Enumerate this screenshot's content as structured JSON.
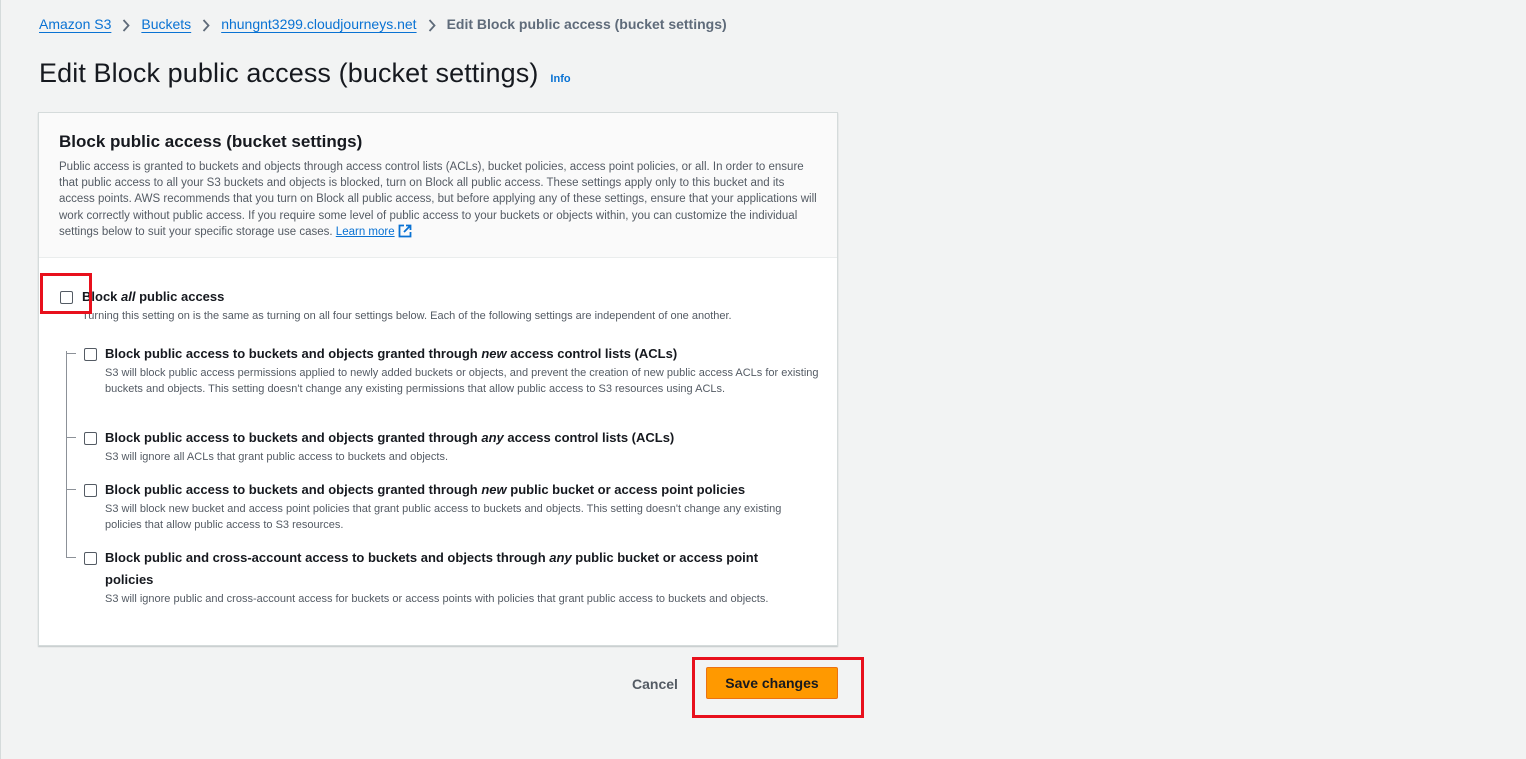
{
  "breadcrumb": {
    "items": [
      "Amazon S3",
      "Buckets",
      "nhungnt3299.cloudjourneys.net"
    ],
    "current": "Edit Block public access (bucket settings)"
  },
  "page": {
    "title": "Edit Block public access (bucket settings)",
    "info_label": "Info"
  },
  "panel": {
    "title": "Block public access (bucket settings)",
    "description": "Public access is granted to buckets and objects through access control lists (ACLs), bucket policies, access point policies, or all. In order to ensure that public access to all your S3 buckets and objects is blocked, turn on Block all public access. These settings apply only to this bucket and its access points. AWS recommends that you turn on Block all public access, but before applying any of these settings, ensure that your applications will work correctly without public access. If you require some level of public access to your buckets or objects within, you can customize the individual settings below to suit your specific storage use cases.",
    "learn_more": "Learn more"
  },
  "block_all": {
    "label_pre": "Block ",
    "label_em": "all",
    "label_post": " public access",
    "description": "Turning this setting on is the same as turning on all four settings below. Each of the following settings are independent of one another.",
    "checked": false
  },
  "settings": [
    {
      "label_pre": "Block public access to buckets and objects granted through ",
      "label_em": "new",
      "label_post": " access control lists (ACLs)",
      "description": "S3 will block public access permissions applied to newly added buckets or objects, and prevent the creation of new public access ACLs for existing buckets and objects. This setting doesn't change any existing permissions that allow public access to S3 resources using ACLs.",
      "checked": false
    },
    {
      "label_pre": "Block public access to buckets and objects granted through ",
      "label_em": "any",
      "label_post": " access control lists (ACLs)",
      "description": "S3 will ignore all ACLs that grant public access to buckets and objects.",
      "checked": false
    },
    {
      "label_pre": "Block public access to buckets and objects granted through ",
      "label_em": "new",
      "label_post": " public bucket or access point policies",
      "description": "S3 will block new bucket and access point policies that grant public access to buckets and objects. This setting doesn't change any existing policies that allow public access to S3 resources.",
      "checked": false
    },
    {
      "label_pre": "Block public and cross-account access to buckets and objects through ",
      "label_em": "any",
      "label_post": " public bucket or access point policies",
      "description": "S3 will ignore public and cross-account access for buckets or access points with policies that grant public access to buckets and objects.",
      "checked": false
    }
  ],
  "actions": {
    "cancel_label": "Cancel",
    "save_label": "Save changes"
  },
  "colors": {
    "link": "#0972d3",
    "primary_button": "#ff9900",
    "highlight": "#e8101c",
    "background": "#f2f3f3"
  },
  "icons": {
    "breadcrumb_separator": "chevron-right-icon",
    "learn_more": "external-link-icon"
  }
}
